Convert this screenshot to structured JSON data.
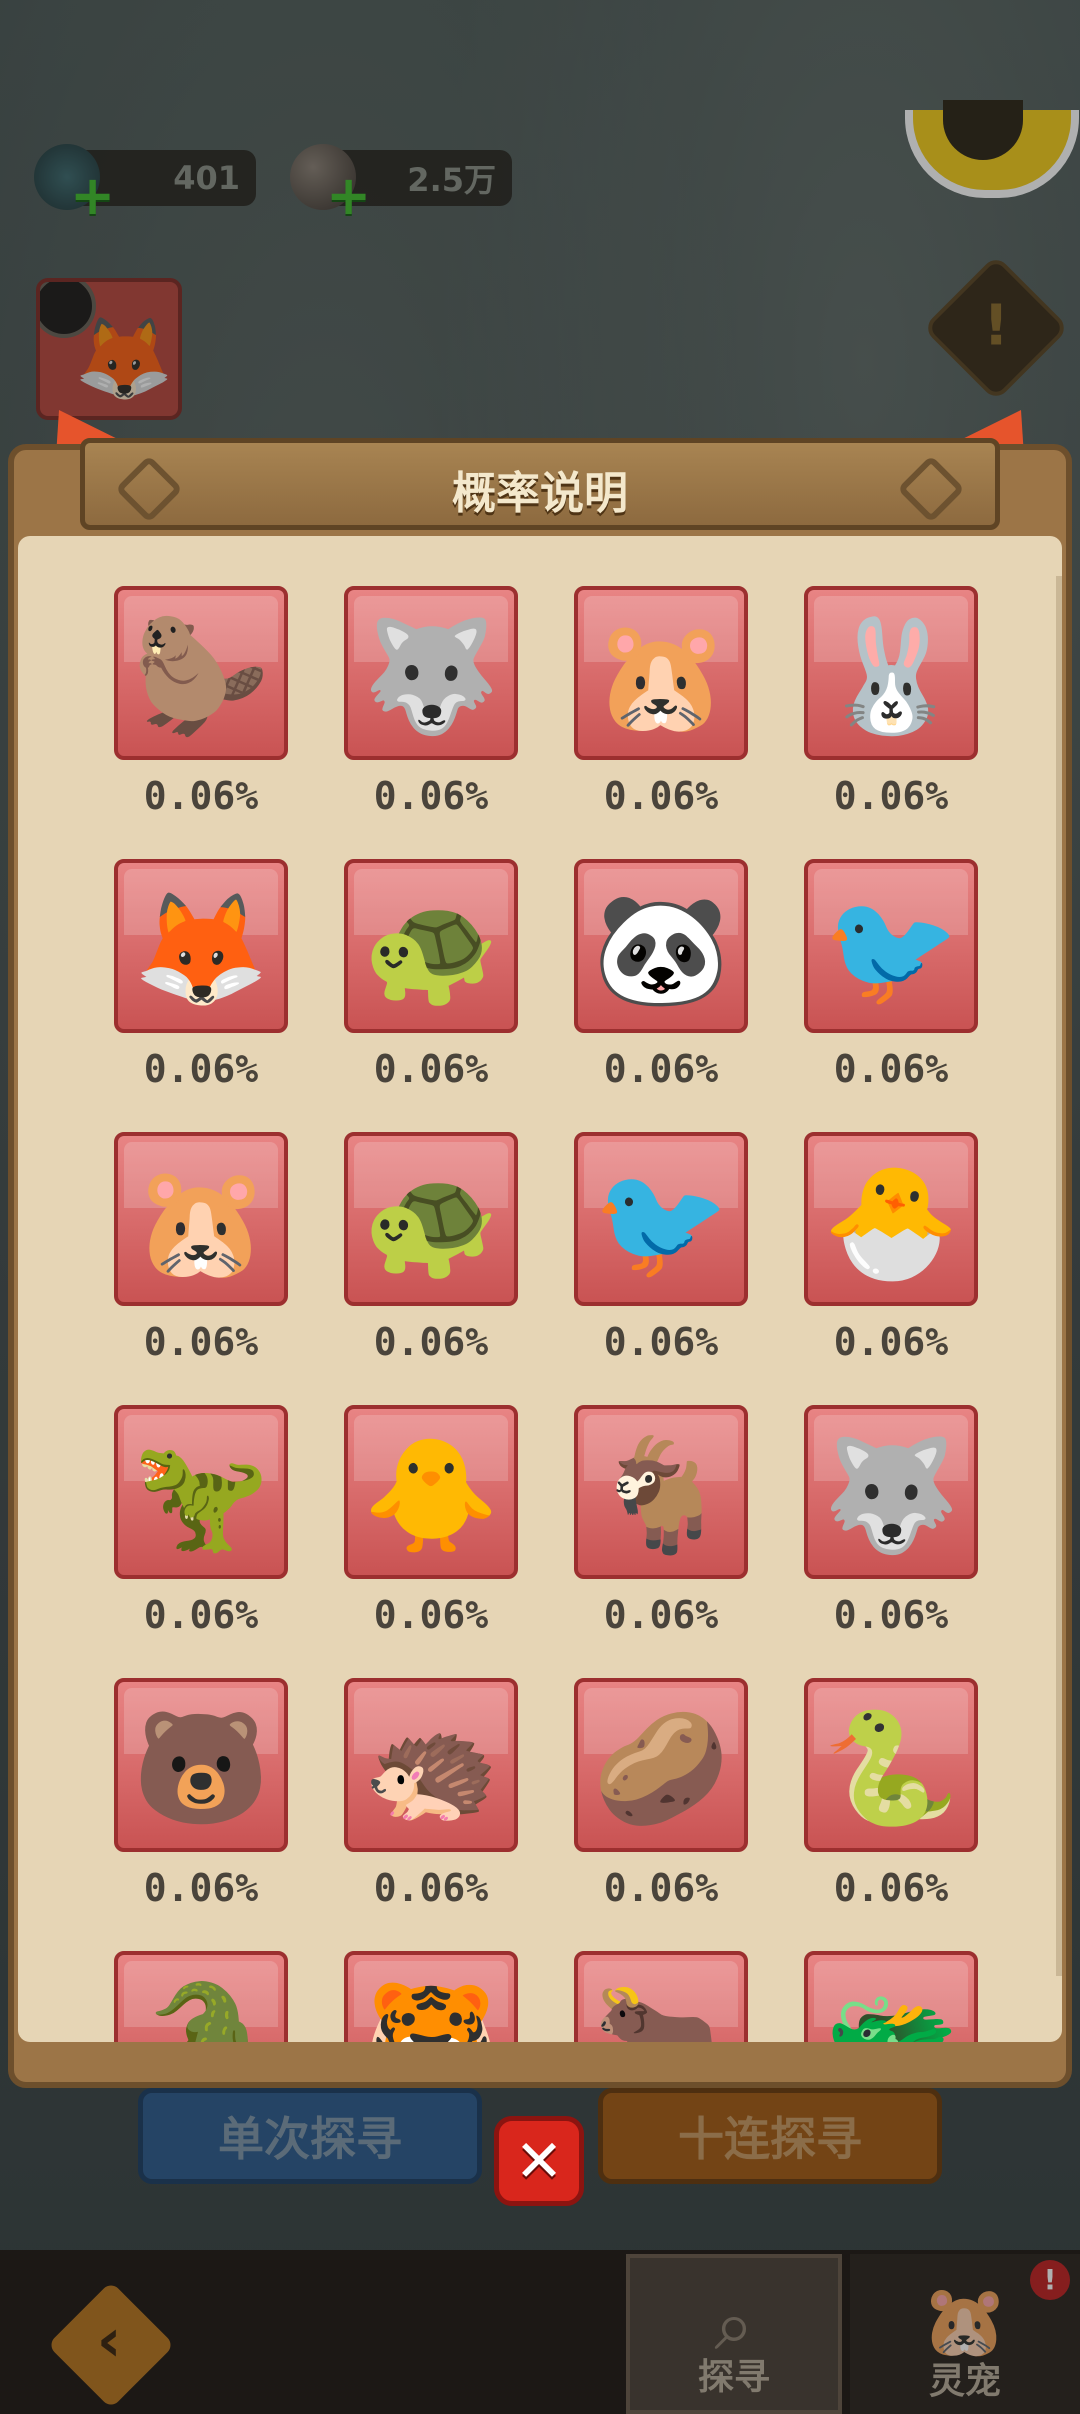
{
  "resources": [
    {
      "name": "dragon-resource",
      "value": "401"
    },
    {
      "name": "stone-resource",
      "value": "2.5万"
    }
  ],
  "modal": {
    "title": "概率说明"
  },
  "pets": [
    {
      "icon": "beaver-pet-icon",
      "glyph": "🦫",
      "percent": "0.06%"
    },
    {
      "icon": "white-wolf-pet-icon",
      "glyph": "🐺",
      "percent": "0.06%"
    },
    {
      "icon": "capybara-pet-icon",
      "glyph": "🐹",
      "percent": "0.06%"
    },
    {
      "icon": "rabbit-pet-icon",
      "glyph": "🐰",
      "percent": "0.06%"
    },
    {
      "icon": "fox-pet-icon",
      "glyph": "🦊",
      "percent": "0.06%"
    },
    {
      "icon": "sprout-turtle-pet-icon",
      "glyph": "🐢",
      "percent": "0.06%"
    },
    {
      "icon": "panda-pet-icon",
      "glyph": "🐼",
      "percent": "0.06%"
    },
    {
      "icon": "blue-bird-pet-icon",
      "glyph": "🐦",
      "percent": "0.06%"
    },
    {
      "icon": "white-blob-pet-icon",
      "glyph": "🐹",
      "percent": "0.06%"
    },
    {
      "icon": "green-turtle-pet-icon",
      "glyph": "🐢",
      "percent": "0.06%"
    },
    {
      "icon": "fire-bird-pet-icon",
      "glyph": "🐦",
      "percent": "0.06%"
    },
    {
      "icon": "chick-egg-pet-icon",
      "glyph": "🐣",
      "percent": "0.06%"
    },
    {
      "icon": "green-dino-pet-icon",
      "glyph": "🦖",
      "percent": "0.06%"
    },
    {
      "icon": "yellow-duck-pet-icon",
      "glyph": "🐥",
      "percent": "0.06%"
    },
    {
      "icon": "goat-pet-icon",
      "glyph": "🐐",
      "percent": "0.06%"
    },
    {
      "icon": "gray-wolf-pet-icon",
      "glyph": "🐺",
      "percent": "0.06%"
    },
    {
      "icon": "bear-pet-icon",
      "glyph": "🐻",
      "percent": "0.06%"
    },
    {
      "icon": "hedgehog-pet-icon",
      "glyph": "🦔",
      "percent": "0.06%"
    },
    {
      "icon": "mandrake-pet-icon",
      "glyph": "🥔",
      "percent": "0.06%"
    },
    {
      "icon": "snake-pet-icon",
      "glyph": "🐍",
      "percent": "0.06%"
    },
    {
      "icon": "crocodile-pet-icon",
      "glyph": "🐊",
      "percent": ""
    },
    {
      "icon": "tiger-pet-icon",
      "glyph": "🐯",
      "percent": ""
    },
    {
      "icon": "ox-pet-icon",
      "glyph": "🐂",
      "percent": ""
    },
    {
      "icon": "blue-dragon-pet-icon",
      "glyph": "🐲",
      "percent": ""
    }
  ],
  "actions": {
    "single": "单次探寻",
    "ten": "十连探寻"
  },
  "tabs": {
    "search": "探寻",
    "pet": "灵宠",
    "pet_badge": "!"
  },
  "colors": {
    "card": "#d65e5e",
    "panel": "#e6d5b5",
    "frame": "#9c7547"
  }
}
